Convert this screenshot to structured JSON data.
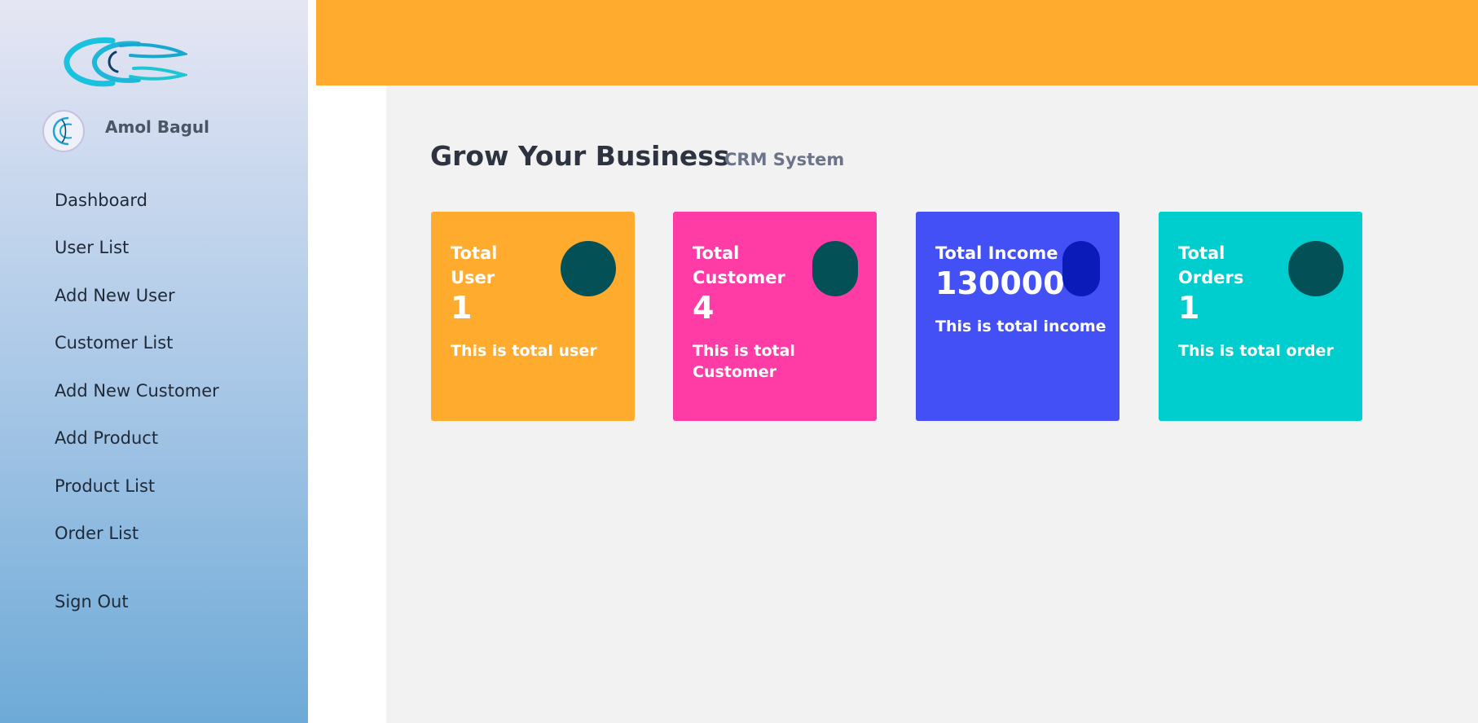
{
  "profile": {
    "name": "Amol Bagul"
  },
  "nav": {
    "items": [
      {
        "label": "Dashboard"
      },
      {
        "label": "User List"
      },
      {
        "label": "Add New User"
      },
      {
        "label": "Customer List"
      },
      {
        "label": "Add New Customer"
      },
      {
        "label": "Add Product"
      },
      {
        "label": "Product List"
      },
      {
        "label": "Order List"
      },
      {
        "label": "Sign Out"
      }
    ]
  },
  "header": {
    "title": "Grow Your Business",
    "subtitle": "CRM System"
  },
  "cards": [
    {
      "title": "Total User",
      "value": "1",
      "description": "This is total user",
      "color": "#ffab2e",
      "icon": "circle-icon"
    },
    {
      "title": "Total Customer",
      "value": "4",
      "description": "This is total Customer",
      "color": "#ff3ba5",
      "icon": "circle-icon"
    },
    {
      "title": "Total Income",
      "value": "130000",
      "description": "This is total income",
      "color": "#4350f5",
      "icon": "pill-icon"
    },
    {
      "title": "Total Orders",
      "value": "1",
      "description": "This is total order",
      "color": "#00cdcd",
      "icon": "circle-icon"
    }
  ],
  "colors": {
    "accent": "#ffab2e",
    "sidebar_top": "#e6e6f3",
    "sidebar_bottom": "#6eaad7",
    "content_bg": "#f2f2f2",
    "icon_dark": "#035156",
    "icon_income": "#0a1bb9"
  }
}
